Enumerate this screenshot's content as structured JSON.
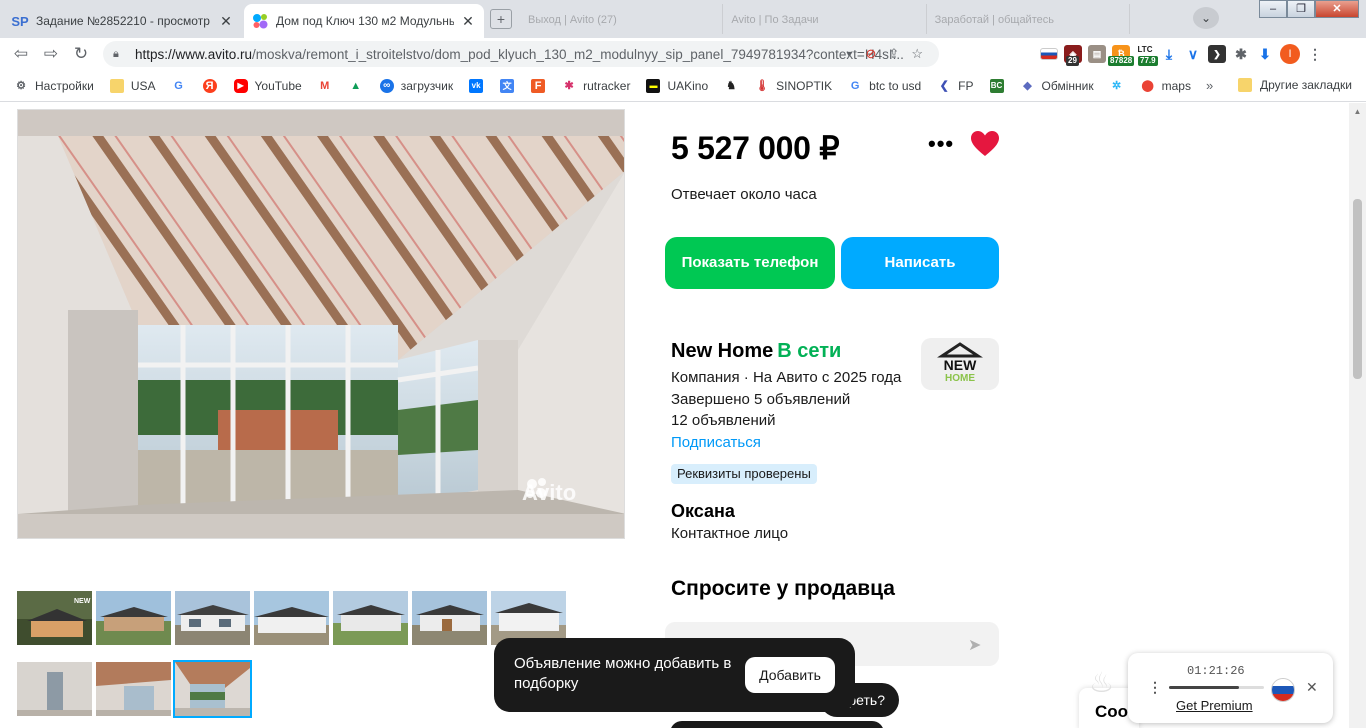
{
  "browser": {
    "tabs": [
      {
        "favicon": "SP",
        "title": "Задание №2852210 - просмотр з",
        "active": false
      },
      {
        "favicon": "avito-dots-icon",
        "title": "Дом под Ключ 130 м2 Модульны",
        "active": true
      }
    ],
    "new_tab": "+",
    "ghost_tabs": [
      "Выход | Avito (27)",
      "Avito | По Задачи",
      "Заработай | общайтесь"
    ],
    "url": "https://www.avito.ru/moskva/remont_i_stroitelstvo/dom_pod_klyuch_130_m2_modulnyy_sip_panel_7949781934?context=H4sI...",
    "url_host": "https://www.avito.ru",
    "url_path": "/moskva/remont_i_stroitelstvo/dom_pod_klyuch_130_m2_modulnyy_sip_panel_7949781934?context=H4sI...",
    "extensions": [
      {
        "name": "russia-flag",
        "badge": ""
      },
      {
        "name": "shield-ext",
        "badge": "29"
      },
      {
        "name": "briefcase-ext",
        "badge": ""
      },
      {
        "name": "bitcoin-ext",
        "badge": "87828"
      },
      {
        "name": "ltc-ext",
        "label": "LTC",
        "badge": "77.9"
      }
    ],
    "profile_initial": "I",
    "bookmarks": [
      {
        "icon": "gear-icon",
        "label": "Настройки"
      },
      {
        "icon": "folder-icon",
        "label": "USA"
      },
      {
        "icon": "google-icon",
        "label": ""
      },
      {
        "icon": "yandex-icon",
        "label": ""
      },
      {
        "icon": "youtube-icon",
        "label": "YouTube"
      },
      {
        "icon": "gmail-icon",
        "label": ""
      },
      {
        "icon": "drive-icon",
        "label": ""
      },
      {
        "icon": "infinity-icon",
        "label": "загрузчик"
      },
      {
        "icon": "vk-icon",
        "label": ""
      },
      {
        "icon": "translate-icon",
        "label": ""
      },
      {
        "icon": "f-icon",
        "label": ""
      },
      {
        "icon": "rutracker-icon",
        "label": "rutracker"
      },
      {
        "icon": "uakino-icon",
        "label": "UAKino"
      },
      {
        "icon": "horse-icon",
        "label": ""
      },
      {
        "icon": "thermometer-icon",
        "label": "SINOPTIK"
      },
      {
        "icon": "google-icon",
        "label": "btc to usd"
      },
      {
        "icon": "fp-icon",
        "label": "FP"
      },
      {
        "icon": "bc-icon",
        "label": ""
      },
      {
        "icon": "diamond-icon",
        "label": "Обмінник"
      },
      {
        "icon": "snowflake-icon",
        "label": ""
      },
      {
        "icon": "maps-icon",
        "label": "maps"
      }
    ],
    "bookmarks_more": "»",
    "other_bookmarks": "Другие закладки"
  },
  "listing": {
    "price": "5 527 000 ₽",
    "reply_time": "Отвечает около часа",
    "show_phone": "Показать телефон",
    "write": "Написать",
    "photo_watermark": "Avito",
    "thumbnail_count": 10,
    "selected_thumbnail": 10
  },
  "seller": {
    "name": "New Home",
    "online": "В сети",
    "logo_top": "NEW",
    "logo_bottom": "HOME",
    "company_line": "Компания · На Авито с 2025 года",
    "completed": "Завершено 5 объявлений",
    "active_ads": "12 объявлений",
    "subscribe": "Подписаться",
    "verified": "Реквизиты проверены",
    "contact_name": "Оксана",
    "contact_role": "Контактное лицо"
  },
  "ask": {
    "title": "Спросите у продавца",
    "chip": "реть?"
  },
  "toast": {
    "message": "Объявление можно добавить в подборку",
    "button": "Добавить"
  },
  "cookie": {
    "text": "Coo"
  },
  "vpn_widget": {
    "timer": "01:21:26",
    "premium": "Get Premium",
    "progress": 0.74
  },
  "colors": {
    "avito_green": "#00c853",
    "avito_blue": "#00aaff",
    "online_green": "#02b156",
    "heart_red": "#e5173f",
    "link_blue": "#0099f7"
  }
}
